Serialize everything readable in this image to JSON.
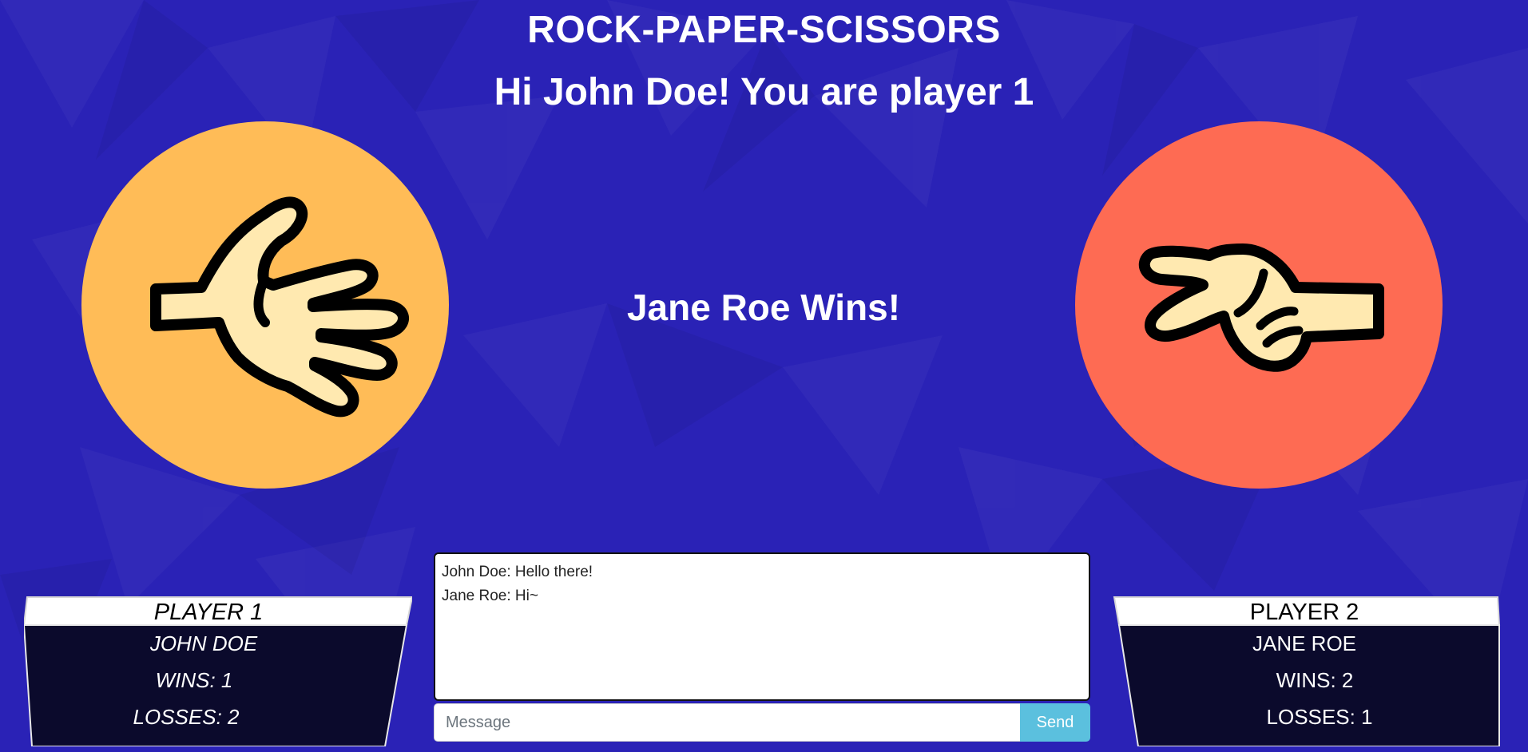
{
  "header": {
    "title": "ROCK-PAPER-SCISSORS",
    "greeting": "Hi John Doe! You are player 1"
  },
  "game": {
    "result": "Jane Roe Wins!",
    "player1_choice": "paper-hand-icon",
    "player2_choice": "scissors-hand-icon"
  },
  "player1": {
    "heading": "PLAYER 1",
    "name": "JOHN DOE",
    "wins": "WINS: 1",
    "losses": "LOSSES: 2"
  },
  "player2": {
    "heading": "PLAYER 2",
    "name": "JANE ROE",
    "wins": "WINS: 2",
    "losses": "LOSSES: 1"
  },
  "chat": {
    "messages": [
      "John Doe: Hello there!",
      "Jane Roe: Hi~"
    ],
    "input_placeholder": "Message",
    "send_label": "Send"
  },
  "colors": {
    "background": "#2a22b6",
    "player1_circle": "#ffbc57",
    "player2_circle": "#fe6b53",
    "hand_fill": "#ffe9b0",
    "panel_dark": "#0b0a2c",
    "send_button": "#5bc0de"
  }
}
